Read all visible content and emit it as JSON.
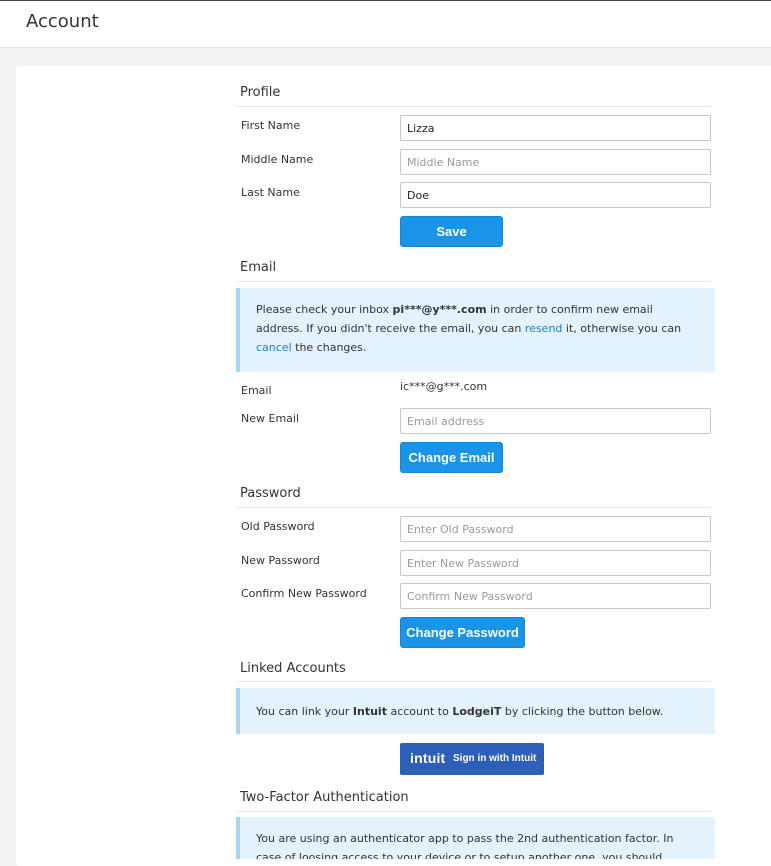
{
  "page": {
    "title": "Account"
  },
  "profile": {
    "title": "Profile",
    "first_name_label": "First Name",
    "first_name_value": "Lizza",
    "middle_name_label": "Middle Name",
    "middle_name_placeholder": "Middle Name",
    "last_name_label": "Last Name",
    "last_name_value": "Doe",
    "save_label": "Save"
  },
  "email": {
    "title": "Email",
    "notice_prefix": "Please check your inbox ",
    "notice_pending_email": "pi***@y***.com",
    "notice_middle": " in order to confirm new email address. If you didn't receive the email, you can ",
    "notice_resend": "resend",
    "notice_middle2": " it, otherwise you can ",
    "notice_cancel": "cancel",
    "notice_suffix": " the changes.",
    "email_label": "Email",
    "email_value": "ic***@g***.com",
    "new_email_label": "New Email",
    "new_email_placeholder": "Email address",
    "change_label": "Change Email"
  },
  "password": {
    "title": "Password",
    "old_label": "Old Password",
    "old_placeholder": "Enter Old Password",
    "new_label": "New Password",
    "new_placeholder": "Enter New Password",
    "confirm_label": "Confirm New Password",
    "confirm_placeholder": "Confirm New Password",
    "change_label": "Change Password"
  },
  "linked": {
    "title": "Linked Accounts",
    "notice_prefix": "You can link your ",
    "notice_provider": "Intuit",
    "notice_middle": " account to ",
    "notice_app": "LodgeiT",
    "notice_suffix": " by clicking the button below.",
    "button_logo": "intuit",
    "button_label": "Sign in with Intuit"
  },
  "twofa": {
    "title": "Two-Factor Authentication",
    "notice": "You are using an authenticator app to pass the 2nd authentication factor. In case of loosing access to your device or to setup another one, you should"
  },
  "colors": {
    "accent": "#1a94e8",
    "intuit_blue": "#2d5fb8",
    "info_background": "#e4f2fd",
    "info_border": "#a9d5f5"
  }
}
